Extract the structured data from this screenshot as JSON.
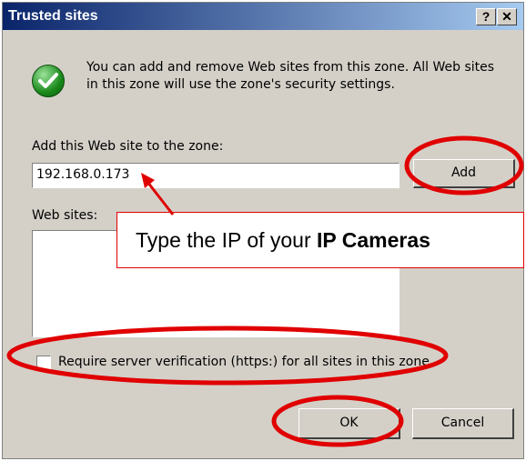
{
  "dialog": {
    "title": "Trusted sites",
    "help_glyph": "?",
    "close_glyph": "✕",
    "info_text": "You can add and remove Web sites from this zone. All Web sites in this zone will use the zone's security settings.",
    "add_label": "Add this Web site to the zone:",
    "site_input_value": "192.168.0.173",
    "add_button": "Add",
    "websites_label": "Web sites:",
    "websites": [],
    "require_https_label": "Require server verification (https:) for all sites in this zone",
    "require_https_checked": false,
    "ok_button": "OK",
    "cancel_button": "Cancel"
  },
  "annotation": {
    "callout_prefix": "Type the IP of your ",
    "callout_bold": "IP Cameras",
    "highlight_color": "#e00000"
  }
}
